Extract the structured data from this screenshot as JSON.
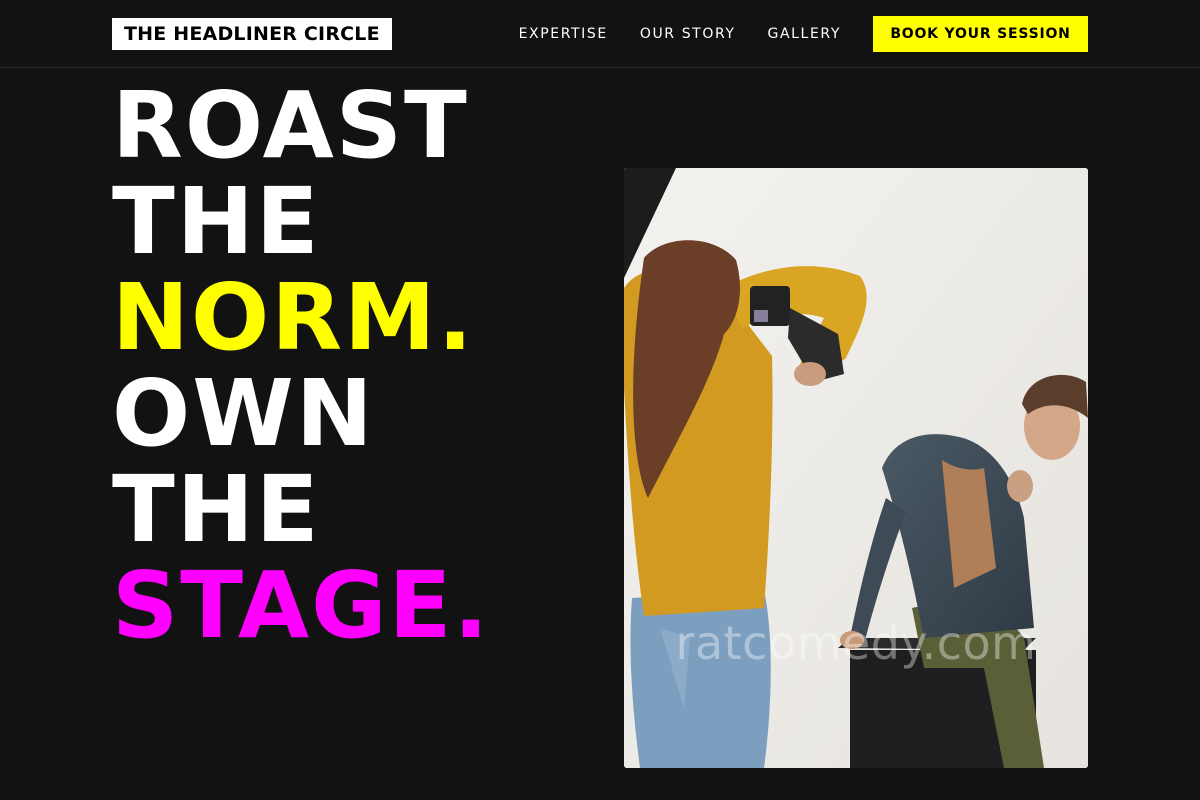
{
  "header": {
    "logo": "THE HEADLINER CIRCLE",
    "nav": [
      {
        "label": "EXPERTISE"
      },
      {
        "label": "OUR STORY"
      },
      {
        "label": "GALLERY"
      }
    ],
    "cta": "BOOK YOUR SESSION"
  },
  "hero": {
    "lines": [
      {
        "text": "ROAST",
        "color": "white"
      },
      {
        "text": "THE",
        "color": "white"
      },
      {
        "text": "NORM.",
        "color": "yellow"
      },
      {
        "text": "OWN",
        "color": "white"
      },
      {
        "text": "THE",
        "color": "white"
      },
      {
        "text": "STAGE.",
        "color": "magenta"
      }
    ],
    "image": {
      "alt": "Photographer with camera shooting a model seated on a black box",
      "watermark": "ratcomedy.com"
    }
  },
  "colors": {
    "background": "#121212",
    "accent_yellow": "#ffff00",
    "accent_magenta": "#ff00ff"
  }
}
